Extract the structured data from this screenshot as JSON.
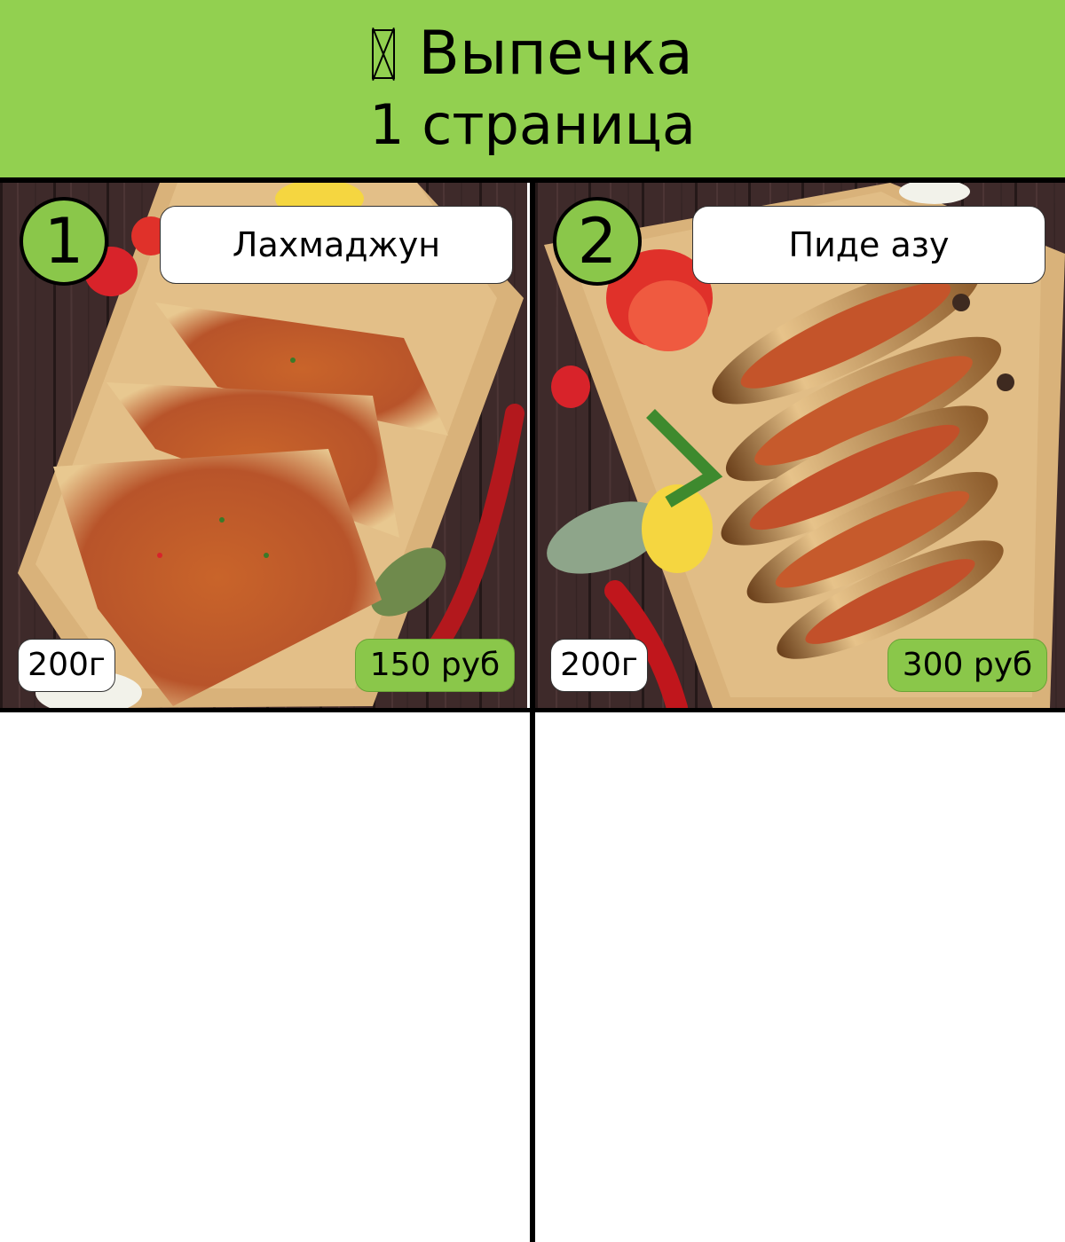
{
  "header": {
    "title": "Выпечка",
    "title_icon": "missing-glyph-icon",
    "subtitle": "1 страница",
    "background_color": "#92d050"
  },
  "products": [
    {
      "number": "1",
      "name": "Лахмаджун",
      "weight": "200г",
      "price": "150 руб",
      "photo": "lahmacun-photo"
    },
    {
      "number": "2",
      "name": "Пиде азу",
      "weight": "200г",
      "price": "300 руб",
      "photo": "pide-photo"
    }
  ],
  "colors": {
    "accent": "#8ac74a",
    "grid_lines": "#000000"
  }
}
